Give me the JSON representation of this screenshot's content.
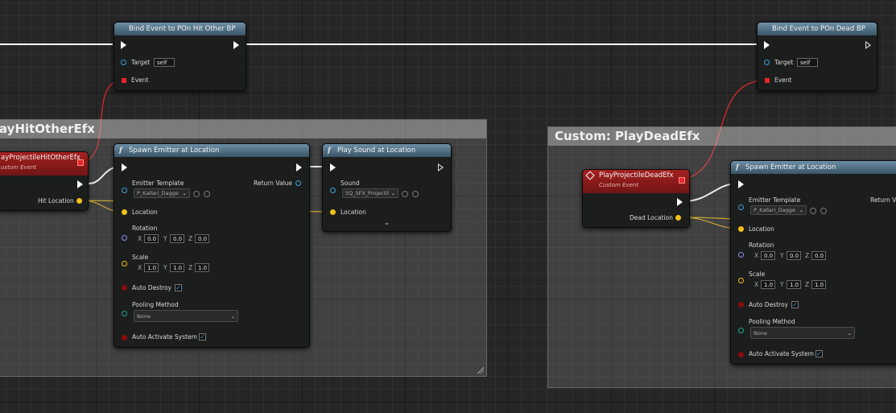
{
  "bind_hit": {
    "title": "Bind Event to POn Hit Other BP",
    "target_label": "Target",
    "target_value": "self",
    "event_label": "Event"
  },
  "bind_dead": {
    "title": "Bind Event to POn Dead BP",
    "target_label": "Target",
    "target_value": "self",
    "event_label": "Event"
  },
  "comment_left": {
    "title": "ayHitOtherEfx"
  },
  "comment_right": {
    "title": "Custom: PlayDeadEfx"
  },
  "event_hit": {
    "title": "ayProjectileHitOtherEfx",
    "subtitle": "ustom Event",
    "pin_label": "Hit Location"
  },
  "event_dead": {
    "title": "PlayProjectileDeadEfx",
    "subtitle": "Custom Event",
    "pin_label": "Dead Location"
  },
  "spawn_left": {
    "title": "Spawn Emitter at Location",
    "emitter_label": "Emitter Template",
    "emitter_value": "P_Kallari_Dagge",
    "return_label": "Return Value",
    "location_label": "Location",
    "rotation_label": "Rotation",
    "rot_x": "0.0",
    "rot_y": "0.0",
    "rot_z": "0.0",
    "scale_label": "Scale",
    "scale_x": "1.0",
    "scale_y": "1.0",
    "scale_z": "1.0",
    "auto_destroy_label": "Auto Destroy",
    "pooling_label": "Pooling Method",
    "pooling_value": "None",
    "auto_activate_label": "Auto Activate System",
    "axis_x": "X",
    "axis_y": "Y",
    "axis_z": "Z"
  },
  "spawn_right": {
    "title": "Spawn Emitter at Location",
    "emitter_label": "Emitter Template",
    "emitter_value": "P_Kallari_Dagge",
    "return_label": "Return V",
    "location_label": "Location",
    "rotation_label": "Rotation",
    "rot_x": "0.0",
    "rot_y": "0.0",
    "rot_z": "0.0",
    "scale_label": "Scale",
    "scale_x": "1.0",
    "scale_y": "1.0",
    "scale_z": "1.0",
    "auto_destroy_label": "Auto Destroy",
    "pooling_label": "Pooling Method",
    "pooling_value": "None",
    "auto_activate_label": "Auto Activate System",
    "axis_x": "X",
    "axis_y": "Y",
    "axis_z": "Z"
  },
  "play_sound": {
    "title": "Play Sound at Location",
    "sound_label": "Sound",
    "sound_value": "SQ_SFX_Projectil",
    "location_label": "Location"
  },
  "icons": {
    "function": "f",
    "chevron": "⌄"
  },
  "colors": {
    "exec": "#ffffff",
    "vector": "#f2c018",
    "delegate": "#e8262a",
    "object": "#3aa1d8",
    "rotator": "#8b8fe6",
    "bool": "#8a0c0c",
    "enum": "#1fa88e"
  }
}
